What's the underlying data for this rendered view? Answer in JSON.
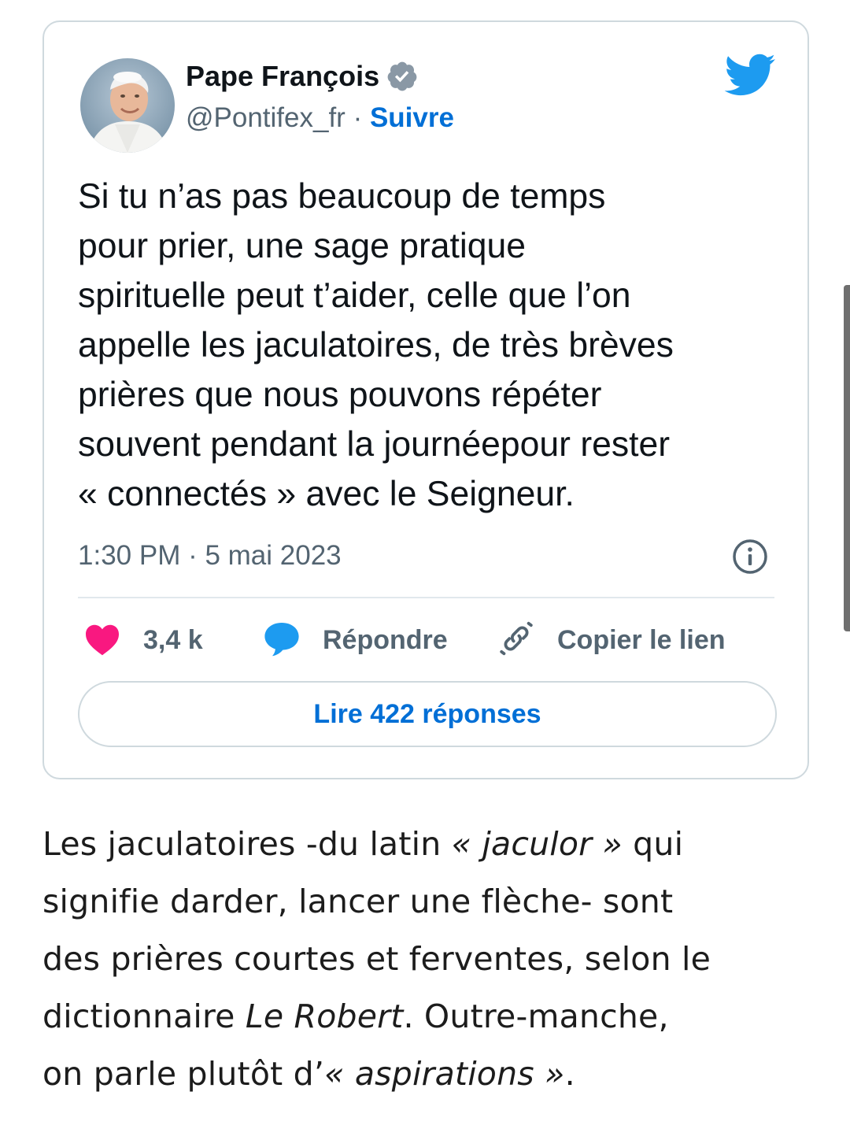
{
  "tweet": {
    "author": {
      "name": "Pape François",
      "handle": "@Pontifex_fr",
      "separator": " · ",
      "follow_label": "Suivre",
      "verified_icon": "verified-badge-icon",
      "avatar_alt": "avatar"
    },
    "brand_icon": "twitter-bird-icon",
    "text_lines": [
      "Si tu n’as pas beaucoup de temps",
      "pour prier, une sage pratique",
      "spirituelle peut t’aider, celle que l’on",
      "appelle les jaculatoires, de très brèves",
      "prières que nous pouvons répéter",
      "souvent pendant la journéepour rester",
      "« connectés » avec le Seigneur."
    ],
    "timestamp": "1:30 PM · 5 mai 2023",
    "info_icon": "info-icon",
    "actions": {
      "likes_count": "3,4 k",
      "reply_label": "Répondre",
      "copy_link_label": "Copier le lien"
    },
    "read_replies_label": "Lire 422 réponses"
  },
  "article": {
    "line1_pre": "Les jaculatoires -du latin ",
    "line1_italic": "« jaculor »",
    "line1_post": " qui",
    "line2": "signifie darder, lancer une flèche- sont",
    "line3": "des prières courtes et ferventes, selon le",
    "line4_pre": "dictionnaire ",
    "line4_italic": "Le Robert",
    "line4_post": ". Outre-manche,",
    "line5_pre": "on parle plutôt d’",
    "line5_italic": "« aspirations »",
    "line5_post": "."
  },
  "colors": {
    "twitter_blue": "#1d9bf0",
    "link_blue": "#006fd6",
    "heart_pink": "#f91880",
    "secondary_text": "#536471",
    "border": "#cfd9de"
  }
}
